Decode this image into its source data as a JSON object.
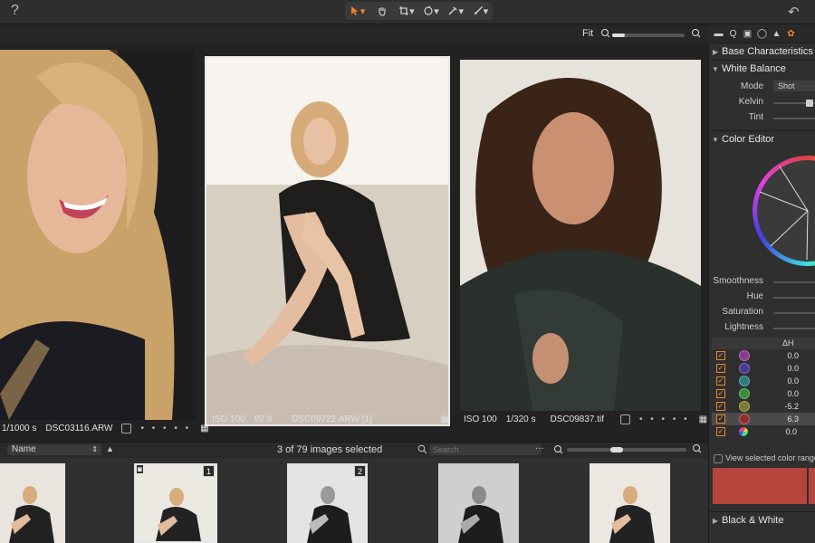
{
  "toolbar": {
    "help_icon": "?",
    "tools": [
      "cursor-icon",
      "hand-icon",
      "crop-icon",
      "rotate-icon",
      "picker-icon",
      "brush-icon"
    ],
    "undo_icon": "↶"
  },
  "viewer": {
    "fit_label": "Fit",
    "photos": [
      {
        "shutter": "1/1000 s",
        "filename": "DSC03116.ARW"
      },
      {
        "iso": "ISO 100",
        "aperture": "f/2.8",
        "filename": "DSC09722.ARW [1]"
      },
      {
        "iso": "ISO 100",
        "shutter": "1/320 s",
        "filename": "DSC09837.tif"
      }
    ],
    "dots": "• • • • •"
  },
  "filmstrip": {
    "sort_label": "Name",
    "sort_icon": "▲",
    "selection_text": "3 of 79 images selected",
    "search_placeholder": "Search",
    "more_icon": "···",
    "badges": [
      "1",
      "2"
    ]
  },
  "panel": {
    "sections": {
      "base": "Base Characteristics",
      "white_balance": "White Balance",
      "color_editor": "Color Editor",
      "black_white": "Black & White"
    },
    "wb": {
      "mode_label": "Mode",
      "mode_value": "Shot",
      "kelvin_label": "Kelvin",
      "tint_label": "Tint"
    },
    "color_editor": {
      "smoothness": "Smoothness",
      "hue": "Hue",
      "saturation": "Saturation",
      "lightness": "Lightness",
      "delta_header": "ΔH",
      "rows": [
        {
          "color": "#8a3a8a",
          "value": "0.0"
        },
        {
          "color": "#4a3a90",
          "value": "0.0"
        },
        {
          "color": "#2f7a80",
          "value": "0.0"
        },
        {
          "color": "#3d8a3d",
          "value": "0.0"
        },
        {
          "color": "#7a7a32",
          "value": "-5.2"
        },
        {
          "color": "#8b2f2f",
          "value": "6.3"
        },
        {
          "color": "rainbow",
          "value": "0.0"
        }
      ],
      "view_selected": "View selected color range",
      "swatch_color": "#b5443c"
    }
  }
}
